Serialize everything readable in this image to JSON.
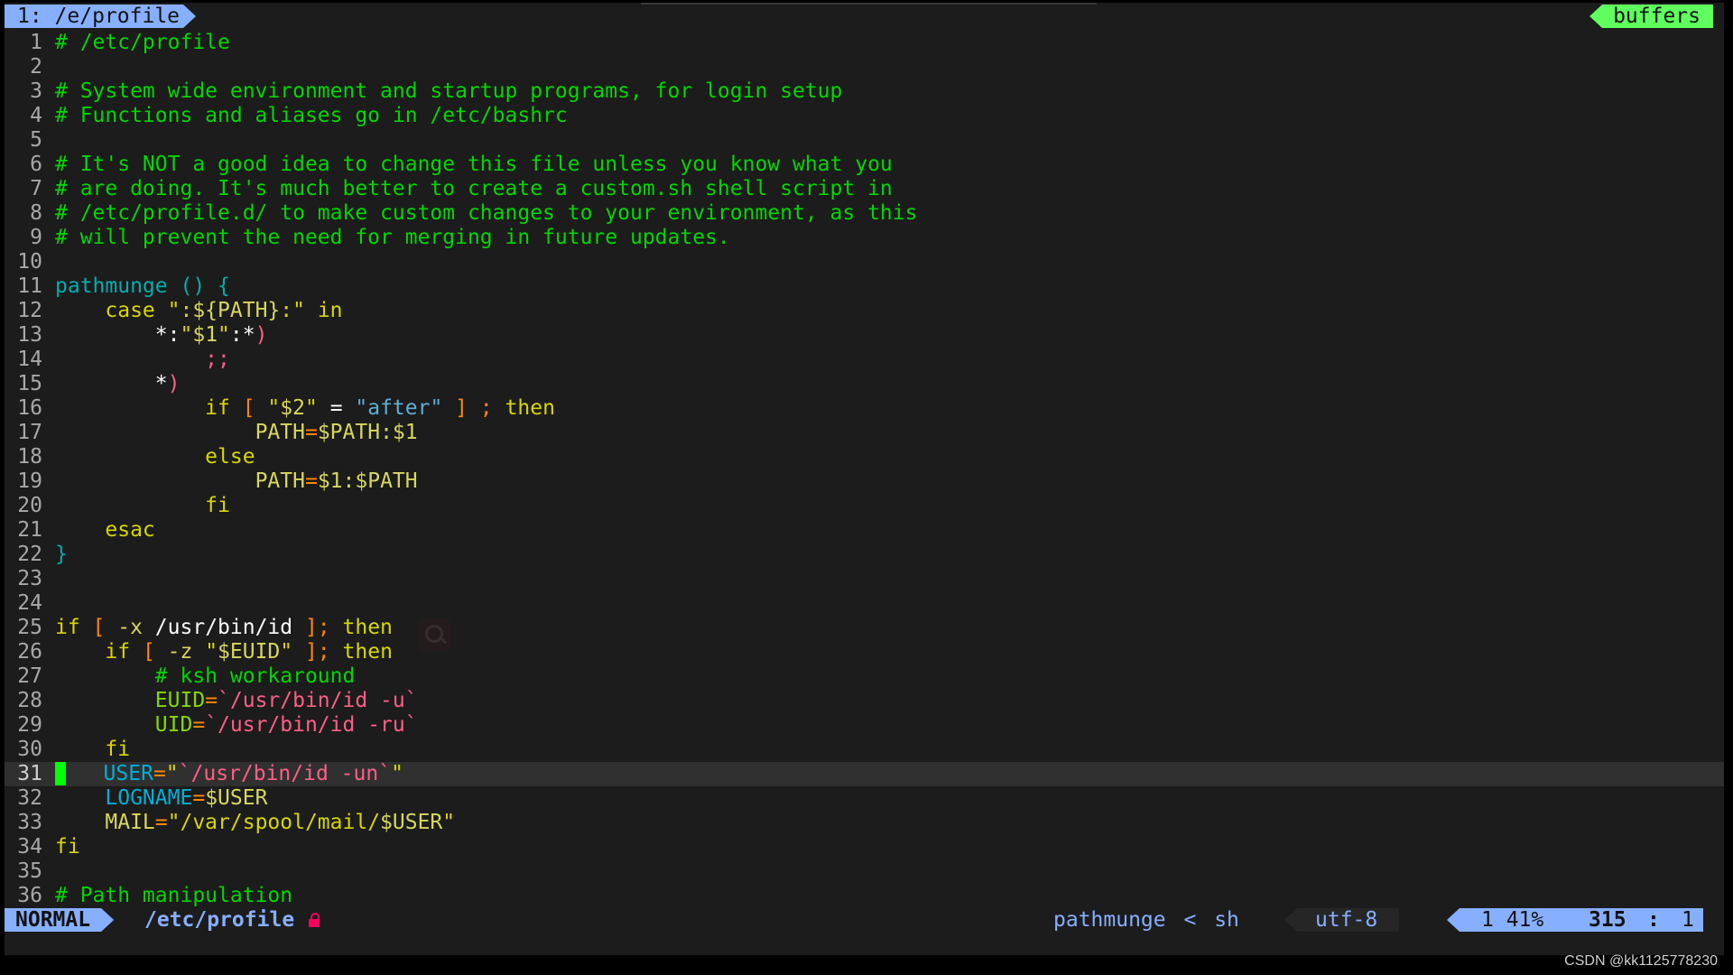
{
  "window": {
    "tab_label": "1: /e/profile",
    "buffers_label": "buffers"
  },
  "editor": {
    "lines": [
      {
        "n": "1",
        "segs": [
          {
            "t": "# /etc/profile",
            "c": "c-comment"
          }
        ]
      },
      {
        "n": "2",
        "segs": []
      },
      {
        "n": "3",
        "segs": [
          {
            "t": "# System wide environment and startup programs, for login setup",
            "c": "c-comment"
          }
        ]
      },
      {
        "n": "4",
        "segs": [
          {
            "t": "# Functions and aliases go in /etc/bashrc",
            "c": "c-comment"
          }
        ]
      },
      {
        "n": "5",
        "segs": []
      },
      {
        "n": "6",
        "segs": [
          {
            "t": "# It's NOT a good idea to change this file unless you know what you",
            "c": "c-comment"
          }
        ]
      },
      {
        "n": "7",
        "segs": [
          {
            "t": "# are doing. It's much better to create a custom.sh shell script in",
            "c": "c-comment"
          }
        ]
      },
      {
        "n": "8",
        "segs": [
          {
            "t": "# /etc/profile.d/ to make custom changes to your environment, as this",
            "c": "c-comment"
          }
        ]
      },
      {
        "n": "9",
        "segs": [
          {
            "t": "# will prevent the need for merging in future updates.",
            "c": "c-comment"
          }
        ]
      },
      {
        "n": "10",
        "segs": []
      },
      {
        "n": "11",
        "segs": [
          {
            "t": "pathmunge",
            "c": "c-func"
          },
          {
            "t": " () {",
            "c": "c-paren"
          }
        ]
      },
      {
        "n": "12",
        "segs": [
          {
            "t": "    ",
            "c": ""
          },
          {
            "t": "case",
            "c": "c-kw"
          },
          {
            "t": " \":",
            "c": "c-str"
          },
          {
            "t": "${PATH}",
            "c": "c-yellow"
          },
          {
            "t": ":\"",
            "c": "c-str"
          },
          {
            "t": " in",
            "c": "c-kw"
          }
        ]
      },
      {
        "n": "13",
        "segs": [
          {
            "t": "        ",
            "c": ""
          },
          {
            "t": "*:",
            "c": "c-white"
          },
          {
            "t": "\"",
            "c": "c-str"
          },
          {
            "t": "$1",
            "c": "c-yellow"
          },
          {
            "t": "\"",
            "c": "c-str"
          },
          {
            "t": ":*",
            "c": "c-white"
          },
          {
            "t": ")",
            "c": "c-pink"
          }
        ]
      },
      {
        "n": "14",
        "segs": [
          {
            "t": "            ",
            "c": ""
          },
          {
            "t": ";;",
            "c": "c-pink"
          }
        ]
      },
      {
        "n": "15",
        "segs": [
          {
            "t": "        ",
            "c": ""
          },
          {
            "t": "*",
            "c": "c-white"
          },
          {
            "t": ")",
            "c": "c-pink"
          }
        ]
      },
      {
        "n": "16",
        "segs": [
          {
            "t": "            ",
            "c": ""
          },
          {
            "t": "if",
            "c": "c-kw"
          },
          {
            "t": " [ ",
            "c": "c-orange"
          },
          {
            "t": "\"",
            "c": "c-str"
          },
          {
            "t": "$2",
            "c": "c-yellow"
          },
          {
            "t": "\"",
            "c": "c-str"
          },
          {
            "t": " = ",
            "c": "c-white"
          },
          {
            "t": "\"after\"",
            "c": "c-cyan"
          },
          {
            "t": " ] ; ",
            "c": "c-orange"
          },
          {
            "t": "then",
            "c": "c-kw"
          }
        ]
      },
      {
        "n": "17",
        "segs": [
          {
            "t": "                ",
            "c": ""
          },
          {
            "t": "PATH",
            "c": "c-yellow"
          },
          {
            "t": "=",
            "c": "c-orange"
          },
          {
            "t": "$PATH",
            "c": "c-yellow"
          },
          {
            "t": ":",
            "c": "c-yellow"
          },
          {
            "t": "$1",
            "c": "c-yellow"
          }
        ]
      },
      {
        "n": "18",
        "segs": [
          {
            "t": "            ",
            "c": ""
          },
          {
            "t": "else",
            "c": "c-kw"
          }
        ]
      },
      {
        "n": "19",
        "segs": [
          {
            "t": "                ",
            "c": ""
          },
          {
            "t": "PATH",
            "c": "c-yellow"
          },
          {
            "t": "=",
            "c": "c-orange"
          },
          {
            "t": "$1",
            "c": "c-yellow"
          },
          {
            "t": ":",
            "c": "c-yellow"
          },
          {
            "t": "$PATH",
            "c": "c-yellow"
          }
        ]
      },
      {
        "n": "20",
        "segs": [
          {
            "t": "            ",
            "c": ""
          },
          {
            "t": "fi",
            "c": "c-kw"
          }
        ]
      },
      {
        "n": "21",
        "segs": [
          {
            "t": "    ",
            "c": ""
          },
          {
            "t": "esac",
            "c": "c-kw"
          }
        ]
      },
      {
        "n": "22",
        "segs": [
          {
            "t": "}",
            "c": "c-paren"
          }
        ]
      },
      {
        "n": "23",
        "segs": []
      },
      {
        "n": "24",
        "segs": []
      },
      {
        "n": "25",
        "segs": [
          {
            "t": "if",
            "c": "c-kw"
          },
          {
            "t": " [ ",
            "c": "c-orange"
          },
          {
            "t": "-x",
            "c": "c-yellow"
          },
          {
            "t": " /usr/bin/id",
            "c": "c-white"
          },
          {
            "t": " ]; ",
            "c": "c-orange"
          },
          {
            "t": "then",
            "c": "c-kw"
          }
        ]
      },
      {
        "n": "26",
        "segs": [
          {
            "t": "    ",
            "c": ""
          },
          {
            "t": "if",
            "c": "c-kw"
          },
          {
            "t": " [ ",
            "c": "c-orange"
          },
          {
            "t": "-z",
            "c": "c-yellow"
          },
          {
            "t": " \"",
            "c": "c-str"
          },
          {
            "t": "$EUID",
            "c": "c-yellow"
          },
          {
            "t": "\"",
            "c": "c-str"
          },
          {
            "t": " ]; ",
            "c": "c-orange"
          },
          {
            "t": "then",
            "c": "c-kw"
          }
        ]
      },
      {
        "n": "27",
        "segs": [
          {
            "t": "        ",
            "c": ""
          },
          {
            "t": "# ksh workaround",
            "c": "c-comment"
          }
        ]
      },
      {
        "n": "28",
        "segs": [
          {
            "t": "        ",
            "c": ""
          },
          {
            "t": "EUID",
            "c": "c-green"
          },
          {
            "t": "=",
            "c": "c-orange"
          },
          {
            "t": "`/usr/bin/id -u`",
            "c": "c-pink"
          }
        ]
      },
      {
        "n": "29",
        "segs": [
          {
            "t": "        ",
            "c": ""
          },
          {
            "t": "UID",
            "c": "c-green"
          },
          {
            "t": "=",
            "c": "c-orange"
          },
          {
            "t": "`/usr/bin/id -ru`",
            "c": "c-pink"
          }
        ]
      },
      {
        "n": "30",
        "segs": [
          {
            "t": "    ",
            "c": ""
          },
          {
            "t": "fi",
            "c": "c-kw"
          }
        ]
      },
      {
        "n": "31",
        "cursor": true,
        "segs": [
          {
            "t": "   ",
            "c": ""
          },
          {
            "t": "USER",
            "c": "c-tealvar"
          },
          {
            "t": "=",
            "c": "c-orange"
          },
          {
            "t": "\"",
            "c": "c-str"
          },
          {
            "t": "`/usr/bin/id -un`",
            "c": "c-pink"
          },
          {
            "t": "\"",
            "c": "c-str"
          }
        ]
      },
      {
        "n": "32",
        "segs": [
          {
            "t": "    ",
            "c": ""
          },
          {
            "t": "LOGNAME",
            "c": "c-tealvar"
          },
          {
            "t": "=",
            "c": "c-orange"
          },
          {
            "t": "$USER",
            "c": "c-yellow"
          }
        ]
      },
      {
        "n": "33",
        "segs": [
          {
            "t": "    ",
            "c": ""
          },
          {
            "t": "MAIL",
            "c": "c-yellow"
          },
          {
            "t": "=",
            "c": "c-orange"
          },
          {
            "t": "\"/var/spool/mail/",
            "c": "c-str"
          },
          {
            "t": "$USER",
            "c": "c-yellow"
          },
          {
            "t": "\"",
            "c": "c-str"
          }
        ]
      },
      {
        "n": "34",
        "segs": [
          {
            "t": "fi",
            "c": "c-kw"
          }
        ]
      },
      {
        "n": "35",
        "segs": []
      },
      {
        "n": "36",
        "segs": [
          {
            "t": "# Path manipulation",
            "c": "c-comment"
          }
        ]
      }
    ]
  },
  "statusline": {
    "mode": "NORMAL",
    "filename": "/etc/profile",
    "function": "pathmunge",
    "separator": "<",
    "filetype": "sh",
    "encoding": "utf-8",
    "percent": "1 41%",
    "line": "315",
    "colon": ":",
    "column": "1"
  },
  "watermark": "CSDN @kk1125778230",
  "icons": {
    "lock": "lock-icon",
    "search": "search-icon"
  },
  "colors": {
    "accent_blue": "#87afff",
    "buffers_green": "#5fff5f",
    "cursor_green": "#00ff00",
    "background": "#1c1c1c",
    "readonly_lock": "#ff005f"
  }
}
